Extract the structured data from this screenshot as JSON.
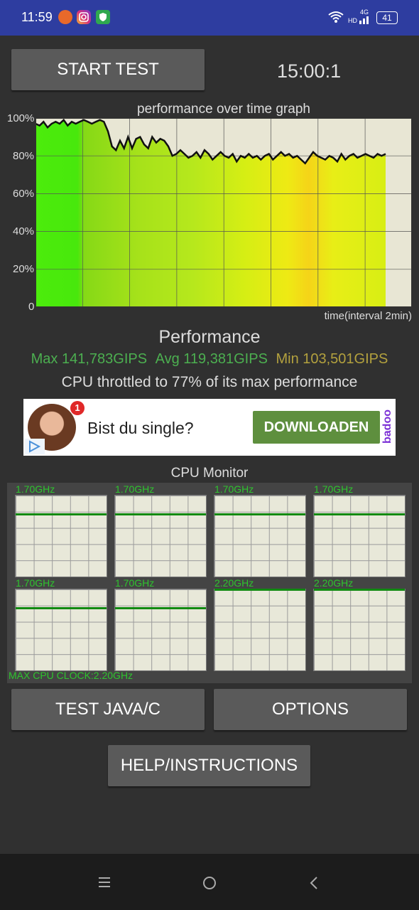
{
  "status_bar": {
    "time": "11:59",
    "network": "4G",
    "network_sub": "HD",
    "battery": "41",
    "icons": [
      "app-icon-orange",
      "instagram-icon",
      "shield-icon",
      "wifi-icon",
      "signal-icon",
      "battery-icon"
    ]
  },
  "controls": {
    "start_test": "START TEST",
    "timer": "15:00:1"
  },
  "graph": {
    "title": "performance over time graph",
    "y_ticks": [
      "100%",
      "80%",
      "60%",
      "40%",
      "20%",
      "0"
    ],
    "x_label": "time(interval 2min)"
  },
  "chart_data": {
    "type": "area",
    "title": "performance over time graph",
    "xlabel": "time(interval 2min)",
    "ylabel": "",
    "ylim": [
      0,
      100
    ],
    "grid": true,
    "y_ticks": [
      "100%",
      "80%",
      "60%",
      "40%",
      "20%",
      "0"
    ],
    "x_intervals_min": [
      0,
      2,
      4,
      6,
      8,
      10,
      12,
      14,
      16
    ],
    "series": [
      {
        "values": [
          97,
          96,
          98,
          95,
          97,
          98,
          97,
          99,
          96,
          98,
          97,
          98,
          99,
          98,
          97,
          98,
          99,
          98,
          93,
          85,
          83,
          88,
          84,
          90,
          84,
          89,
          90,
          86,
          84,
          90,
          87,
          89,
          88,
          85,
          80,
          81,
          83,
          81,
          79,
          80,
          82,
          79,
          83,
          81,
          78,
          80,
          82,
          80,
          79,
          81,
          77,
          80,
          79,
          81,
          79,
          80,
          78,
          80,
          81,
          78,
          80,
          82,
          80,
          81,
          79,
          80,
          78,
          76,
          79,
          82,
          80,
          79,
          78,
          80,
          79,
          77,
          81,
          78,
          80,
          81,
          79,
          80,
          81,
          80,
          79,
          81,
          80,
          81
        ]
      }
    ]
  },
  "performance": {
    "heading": "Performance",
    "max": "Max 141,783GIPS",
    "avg": "Avg 119,381GIPS",
    "min": "Min 103,501GIPS",
    "throttle_text": "CPU throttled to 77% of its max performance"
  },
  "ad": {
    "badge": "1",
    "text": "Bist du single?",
    "button": "DOWNLOADEN",
    "brand": "badoo"
  },
  "cpu_monitor": {
    "title": "CPU Monitor",
    "max_clock": "MAX CPU CLOCK:2.20GHz",
    "cores": [
      {
        "freq": "1.70GHz",
        "level": 0.77
      },
      {
        "freq": "1.70GHz",
        "level": 0.77
      },
      {
        "freq": "1.70GHz",
        "level": 0.77
      },
      {
        "freq": "1.70GHz",
        "level": 0.77
      },
      {
        "freq": "1.70GHz",
        "level": 0.77
      },
      {
        "freq": "1.70GHz",
        "level": 0.77
      },
      {
        "freq": "2.20GHz",
        "level": 1.0
      },
      {
        "freq": "2.20GHz",
        "level": 1.0
      }
    ]
  },
  "buttons": {
    "test_java": "TEST JAVA/C",
    "options": "OPTIONS",
    "help": "HELP/INSTRUCTIONS"
  },
  "nav": {
    "icons": [
      "menu-icon",
      "home-icon",
      "back-icon"
    ]
  },
  "colors": {
    "status_bar": "#2e3da0",
    "background": "#303030",
    "button": "#5a5a5a",
    "stat_green": "#4caf50",
    "stat_yellow": "#b3a13e",
    "cpu_green": "#2ec42e",
    "ad_button": "#5e8f3e"
  }
}
